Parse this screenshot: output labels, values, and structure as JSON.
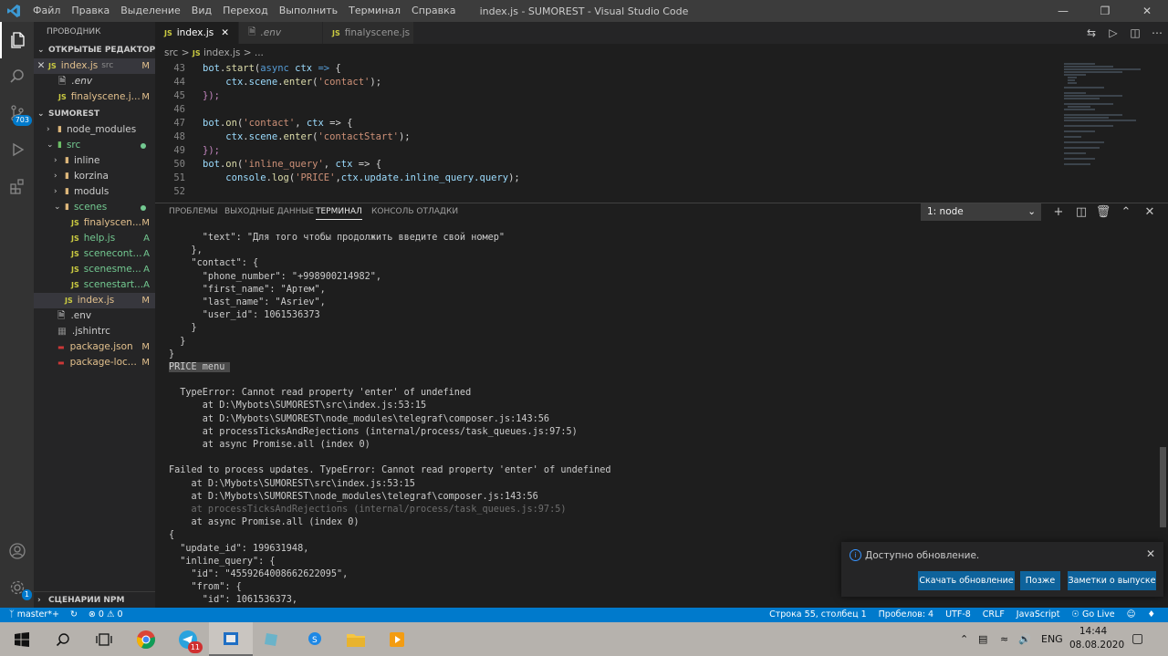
{
  "window": {
    "title": "index.js - SUMOREST - Visual Studio Code",
    "menu": [
      "Файл",
      "Правка",
      "Выделение",
      "Вид",
      "Переход",
      "Выполнить",
      "Терминал",
      "Справка"
    ]
  },
  "activity_bar": {
    "scm_badge": "703",
    "settings_badge": "1"
  },
  "sidebar": {
    "title": "ПРОВОДНИК",
    "open_editors_header": "ОТКРЫТЫЕ РЕДАКТОРЫ",
    "open_editors": [
      {
        "icon": "JS",
        "name": "index.js",
        "hint": "src",
        "status": "M"
      },
      {
        "icon": "",
        "name": ".env",
        "hint": "",
        "status": ""
      },
      {
        "icon": "JS",
        "name": "finalyscene.j...",
        "hint": "",
        "status": "M"
      }
    ],
    "project_header": "SUMOREST",
    "tree": [
      {
        "name": "node_modules"
      },
      {
        "name": "src"
      },
      {
        "name": "inline"
      },
      {
        "name": "korzina"
      },
      {
        "name": "moduls"
      },
      {
        "name": "scenes"
      },
      {
        "name": "finalyscen...",
        "status": "M"
      },
      {
        "name": "help.js",
        "status": "A"
      },
      {
        "name": "scenecont...",
        "status": "A"
      },
      {
        "name": "scenesme...",
        "status": "A"
      },
      {
        "name": "scenestart...",
        "status": "A"
      },
      {
        "name": "index.js",
        "status": "M"
      },
      {
        "name": ".env"
      },
      {
        "name": ".jshintrc"
      },
      {
        "name": "package.json",
        "status": "M"
      },
      {
        "name": "package-loc...",
        "status": "M"
      }
    ],
    "npm_header": "СЦЕНАРИИ NPM"
  },
  "tabs": [
    {
      "icon": "JS",
      "label": "index.js"
    },
    {
      "icon": "",
      "label": ".env"
    },
    {
      "icon": "JS",
      "label": "finalyscene.js"
    }
  ],
  "breadcrumb": {
    "folder": "src",
    "sep": ">",
    "icon": "JS",
    "file": "index.js",
    "more": "> ..."
  },
  "code": {
    "line_numbers": [
      "43",
      "44",
      "45",
      "46",
      "47",
      "48",
      "49",
      "50",
      "51",
      "52"
    ],
    "l43_a": "bot",
    "l43_b": ".",
    "l43_c": "start",
    "l43_d": "(",
    "l43_e": "async",
    "l43_f": " ctx ",
    "l43_g": "=>",
    "l43_h": " {",
    "l44_a": "ctx",
    "l44_b": ".",
    "l44_c": "scene",
    "l44_d": ".",
    "l44_e": "enter",
    "l44_f": "(",
    "l44_g": "'contact'",
    "l44_h": ");",
    "l45": "});",
    "l47_a": "bot",
    "l47_b": ".",
    "l47_c": "on",
    "l47_d": "(",
    "l47_e": "'contact'",
    "l47_f": ", ",
    "l47_g": "ctx",
    "l47_h": " => {",
    "l48_a": "ctx",
    "l48_b": ".",
    "l48_c": "scene",
    "l48_d": ".",
    "l48_e": "enter",
    "l48_f": "(",
    "l48_g": "'contactStart'",
    "l48_h": ");",
    "l49": "});",
    "l50_a": "bot",
    "l50_b": ".",
    "l50_c": "on",
    "l50_d": "(",
    "l50_e": "'inline_query'",
    "l50_f": ", ",
    "l50_g": "ctx",
    "l50_h": " => {",
    "l51_a": "console",
    "l51_b": ".",
    "l51_c": "log",
    "l51_d": "(",
    "l51_e": "'PRICE'",
    "l51_f": ",",
    "l51_g": "ctx.update.inline_query.query",
    "l51_h": ");"
  },
  "panel": {
    "tabs": [
      "ПРОБЛЕМЫ",
      "ВЫХОДНЫЕ ДАННЫЕ",
      "ТЕРМИНАЛ",
      "КОНСОЛЬ ОТЛАДКИ"
    ],
    "active_tab": "ТЕРМИНАЛ",
    "terminal_select": "1: node",
    "terminal_lines": [
      "      \"text\": \"Для того чтобы продолжить введите свой номер\"",
      "    },",
      "    \"contact\": {",
      "      \"phone_number\": \"+998900214982\",",
      "      \"first_name\": \"Артем\",",
      "      \"last_name\": \"Asriev\",",
      "      \"user_id\": 1061536373",
      "    }",
      "  }",
      "}",
      "PRICE menu ",
      "",
      "  TypeError: Cannot read property 'enter' of undefined",
      "      at D:\\Mybots\\SUMOREST\\src\\index.js:53:15",
      "      at D:\\Mybots\\SUMOREST\\node_modules\\telegraf\\composer.js:143:56",
      "      at processTicksAndRejections (internal/process/task_queues.js:97:5)",
      "      at async Promise.all (index 0)",
      "",
      "Failed to process updates. TypeError: Cannot read property 'enter' of undefined",
      "    at D:\\Mybots\\SUMOREST\\src\\index.js:53:15",
      "    at D:\\Mybots\\SUMOREST\\node_modules\\telegraf\\composer.js:143:56",
      "    at processTicksAndRejections (internal/process/task_queues.js:97:5)",
      "    at async Promise.all (index 0)",
      "{",
      "  \"update_id\": 199631948,",
      "  \"inline_query\": {",
      "    \"id\": \"4559264008662622095\",",
      "    \"from\": {",
      "      \"id\": 1061536373,"
    ]
  },
  "notification": {
    "message": "Доступно обновление.",
    "buttons": [
      "Скачать обновление",
      "Позже",
      "Заметки о выпуске"
    ]
  },
  "statusbar": {
    "branch": "master*+",
    "problems": "⊗ 0 ⚠ 0",
    "position": "Строка 55, столбец 1",
    "spaces": "Пробелов: 4",
    "encoding": "UTF-8",
    "eol": "CRLF",
    "language": "JavaScript",
    "golive": "Go Live"
  },
  "taskbar": {
    "telegram_badge": "11",
    "language": "ENG",
    "time": "14:44",
    "date": "08.08.2020"
  },
  "colors": {
    "accent": "#007acc",
    "editor_bg": "#1e1e1e",
    "sidebar_bg": "#252526",
    "modified": "#e2c08d",
    "added": "#73c991"
  }
}
